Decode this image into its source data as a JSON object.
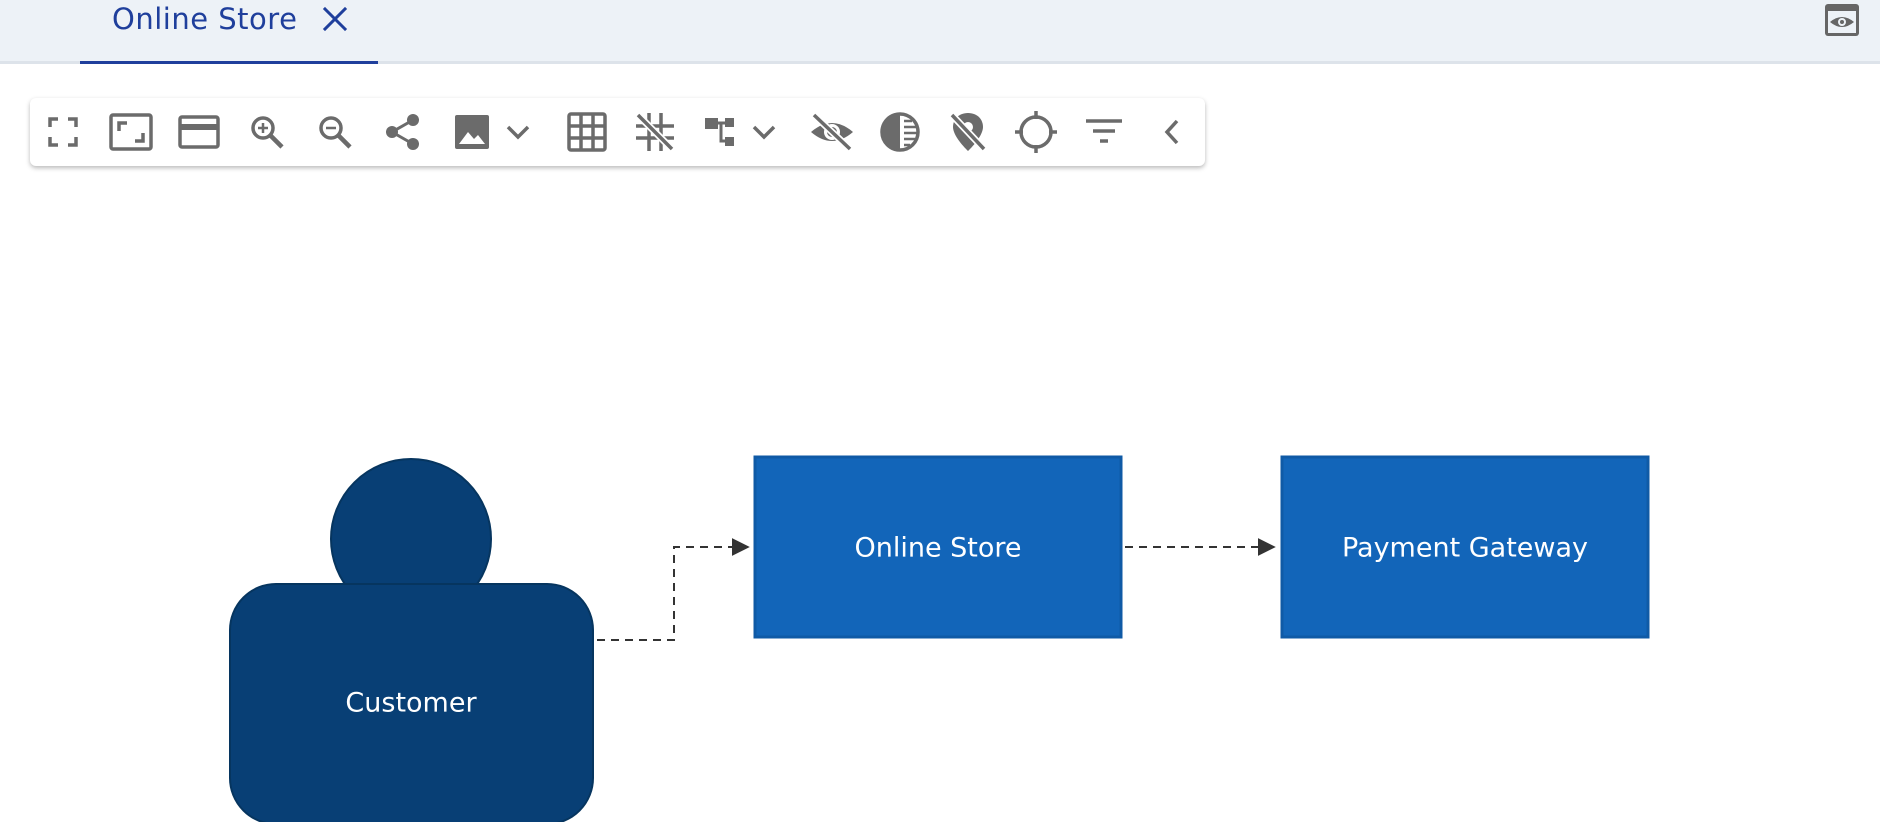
{
  "tab": {
    "label": "Online Store"
  },
  "toolbar": {
    "tools": [
      {
        "name": "fullscreen"
      },
      {
        "name": "fit-to-screen"
      },
      {
        "name": "card-view"
      },
      {
        "name": "zoom-in"
      },
      {
        "name": "zoom-out"
      },
      {
        "name": "share"
      },
      {
        "name": "export-image"
      },
      {
        "name": "export-dropdown"
      },
      {
        "name": "grid"
      },
      {
        "name": "snap-off"
      },
      {
        "name": "layout"
      },
      {
        "name": "layout-dropdown"
      },
      {
        "name": "hide"
      },
      {
        "name": "contrast"
      },
      {
        "name": "location-off"
      },
      {
        "name": "focus"
      },
      {
        "name": "filter"
      },
      {
        "name": "collapse"
      }
    ]
  },
  "diagram": {
    "nodes": {
      "customer": {
        "label": "Customer",
        "color": "#083f75"
      },
      "online_store": {
        "label": "Online Store",
        "color": "#1265b9"
      },
      "payment_gateway": {
        "label": "Payment Gateway",
        "color": "#1265b9"
      }
    },
    "edges": [
      {
        "from": "Customer",
        "to": "Online Store",
        "style": "dashed"
      },
      {
        "from": "Online Store",
        "to": "Payment Gateway",
        "style": "dashed"
      }
    ]
  },
  "colors": {
    "accent": "#1f3f9c",
    "icon": "#6b6b6b",
    "edge": "#333333"
  }
}
